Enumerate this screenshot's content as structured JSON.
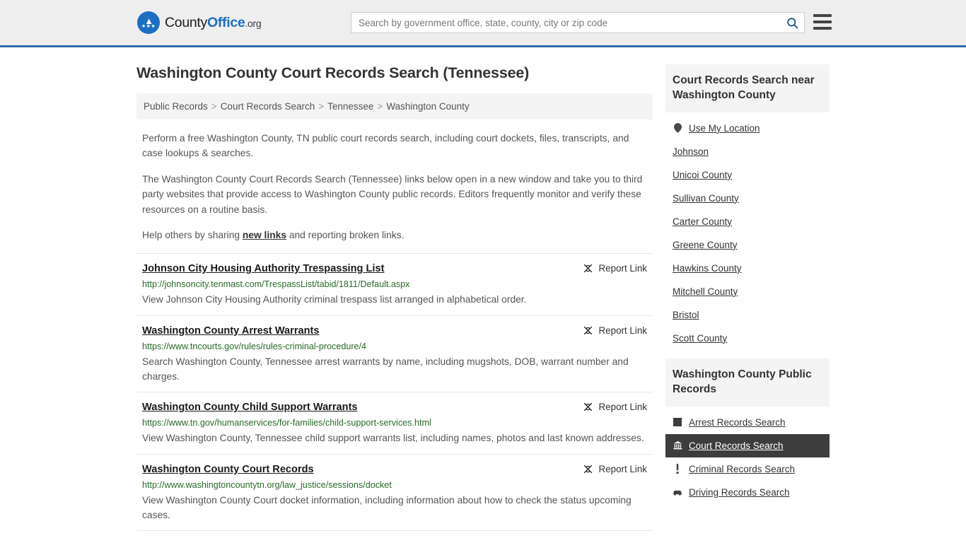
{
  "header": {
    "logo": {
      "part1": "County",
      "part2": "Office",
      "part3": ".org",
      "icon": "eagle-seal-icon"
    },
    "search": {
      "placeholder": "Search by government office, state, county, city or zip code",
      "value": "",
      "icon": "search-icon"
    },
    "menu_icon": "hamburger-menu-icon",
    "accent_color": "#2f6ca5",
    "background_color": "#eeeeee"
  },
  "page": {
    "title": "Washington County Court Records Search (Tennessee)"
  },
  "breadcrumb": {
    "items": [
      {
        "label": "Public Records"
      },
      {
        "label": "Court Records Search"
      },
      {
        "label": "Tennessee"
      },
      {
        "label": "Washington County"
      }
    ],
    "separator": ">"
  },
  "intro": {
    "p1": "Perform a free Washington County, TN public court records search, including court dockets, files, transcripts, and case lookups & searches.",
    "p2": "The Washington County Court Records Search (Tennessee) links below open in a new window and take you to third party websites that provide access to Washington County public records. Editors frequently monitor and verify these resources on a routine basis.",
    "p3_before": "Help others by sharing ",
    "p3_link": "new links",
    "p3_after": " and reporting broken links."
  },
  "results": {
    "report_label": "Report Link",
    "report_icon": "broken-link-icon",
    "items": [
      {
        "title": "Johnson City Housing Authority Trespassing List",
        "url": "http://johnsoncity.tenmast.com/TrespassList/tabid/1811/Default.aspx",
        "description": "View Johnson City Housing Authority criminal trespass list arranged in alphabetical order."
      },
      {
        "title": "Washington County Arrest Warrants",
        "url": "https://www.tncourts.gov/rules/rules-criminal-procedure/4",
        "description": "Search Washington County, Tennessee arrest warrants by name, including mugshots, DOB, warrant number and charges."
      },
      {
        "title": "Washington County Child Support Warrants",
        "url": "https://www.tn.gov/humanservices/for-families/child-support-services.html",
        "description": "View Washington County, Tennessee child support warrants list, including names, photos and last known addresses."
      },
      {
        "title": "Washington County Court Records",
        "url": "http://www.washingtoncountytn.org/law_justice/sessions/docket",
        "description": "View Washington County Court docket information, including information about how to check the status upcoming cases."
      }
    ]
  },
  "sidebar": {
    "nearby": {
      "heading": "Court Records Search near Washington County",
      "items": [
        {
          "label": "Use My Location",
          "icon": "map-pin-icon"
        },
        {
          "label": "Johnson",
          "icon": ""
        },
        {
          "label": "Unicoi County",
          "icon": ""
        },
        {
          "label": "Sullivan County",
          "icon": ""
        },
        {
          "label": "Carter County",
          "icon": ""
        },
        {
          "label": "Greene County",
          "icon": ""
        },
        {
          "label": "Hawkins County",
          "icon": ""
        },
        {
          "label": "Mitchell County",
          "icon": ""
        },
        {
          "label": "Bristol",
          "icon": ""
        },
        {
          "label": "Scott County",
          "icon": ""
        }
      ]
    },
    "public_records": {
      "heading": "Washington County Public Records",
      "active_label": "Court Records Search",
      "items": [
        {
          "label": "Arrest Records Search",
          "icon": "fingerprint-icon",
          "active": false
        },
        {
          "label": "Court Records Search",
          "icon": "courthouse-icon",
          "active": true
        },
        {
          "label": "Criminal Records Search",
          "icon": "exclamation-icon",
          "active": false
        },
        {
          "label": "Driving Records Search",
          "icon": "car-icon",
          "active": false
        }
      ]
    }
  }
}
